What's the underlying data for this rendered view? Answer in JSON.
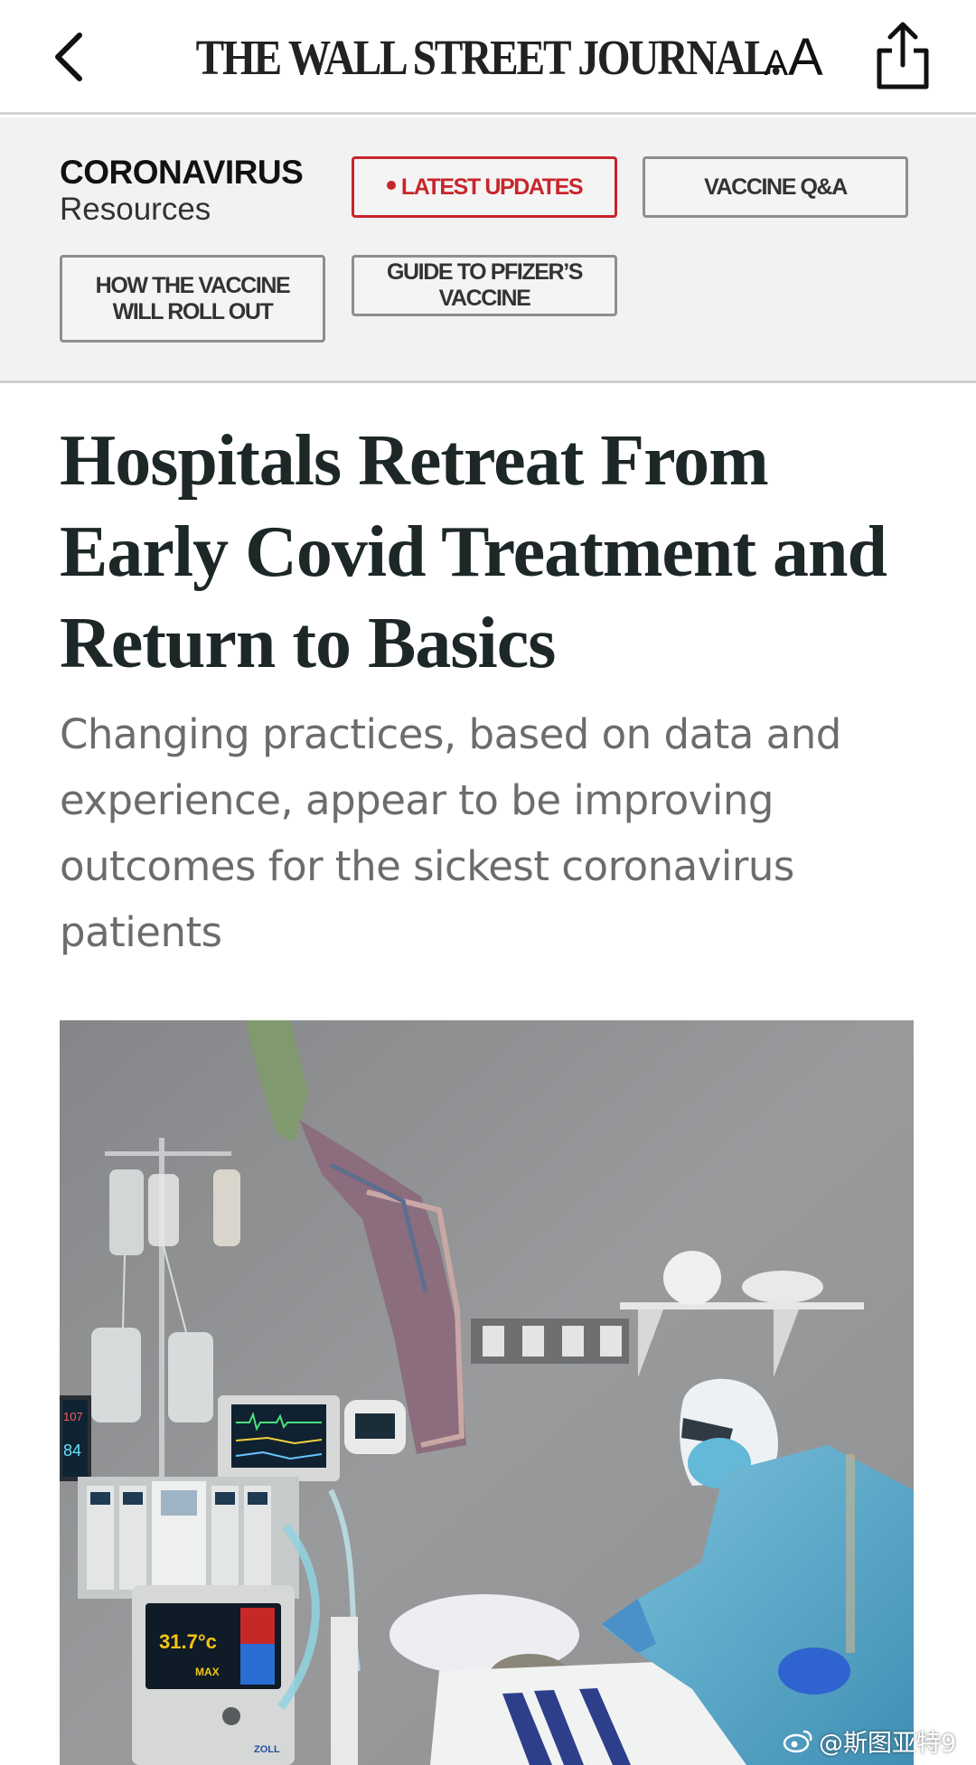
{
  "header": {
    "masthead": "THE WALL STREET JOURNAL.",
    "text_size_small": "A",
    "text_size_large": "A",
    "icons": [
      "chevron-left-icon",
      "text-size-icon",
      "share-icon"
    ]
  },
  "resources": {
    "title": "CORONAVIRUS",
    "subtitle": "Resources",
    "chips": [
      {
        "label": "LATEST UPDATES",
        "live": true
      },
      {
        "label": "VACCINE Q&A",
        "live": false
      },
      {
        "label": "HOW THE VACCINE WILL ROLL OUT",
        "live": false
      },
      {
        "label": "GUIDE TO PFIZER’S VACCINE",
        "live": false
      }
    ],
    "accent_color": "#c8252b"
  },
  "article": {
    "headline": "Hospitals Retreat From Early Covid Treatment and Return to Basics",
    "dek": "Changing practices, based on data and experience, appear to be improving outcomes for the sickest coronavirus patients",
    "photo_monitor_text": {
      "pump_readout": "31.7°c",
      "pump_label": "MAX",
      "pump_brand": "ZOLL",
      "side_monitor_top": "107",
      "side_monitor_bottom": "84"
    }
  },
  "watermark": {
    "text": "@斯图亚特9"
  }
}
